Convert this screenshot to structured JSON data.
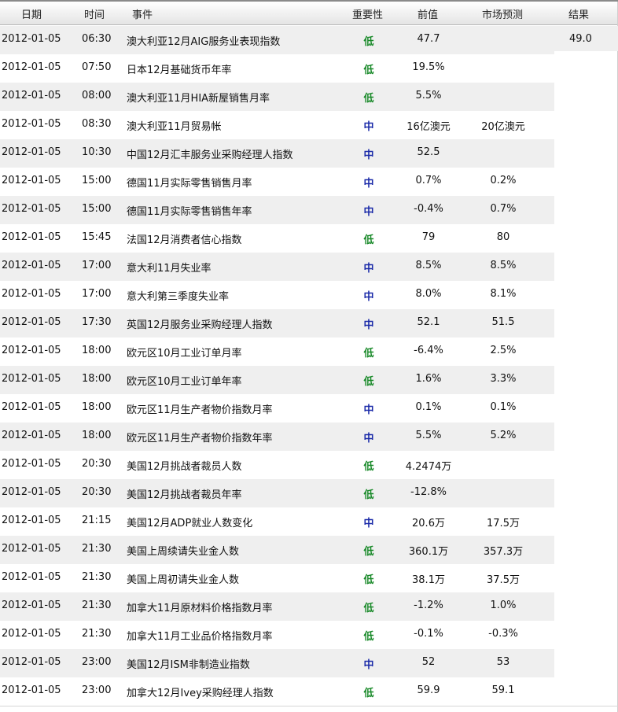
{
  "columns": {
    "date": "日期",
    "time": "时间",
    "event": "事件",
    "importance": "重要性",
    "previous": "前值",
    "forecast": "市场预测",
    "result": "结果"
  },
  "colors": {
    "low": "#1a8a2a",
    "mid": "#1a2aa8",
    "row_shade": "#efefef"
  },
  "rows": [
    {
      "date": "2012-01-05",
      "time": "06:30",
      "event": "澳大利亚12月AIG服务业表现指数",
      "importance": "低",
      "previous": "47.7",
      "forecast": "",
      "result": "49.0"
    },
    {
      "date": "2012-01-05",
      "time": "07:50",
      "event": "日本12月基础货币年率",
      "importance": "低",
      "previous": "19.5%",
      "forecast": "",
      "result": ""
    },
    {
      "date": "2012-01-05",
      "time": "08:00",
      "event": "澳大利亚11月HIA新屋销售月率",
      "importance": "低",
      "previous": "5.5%",
      "forecast": "",
      "result": ""
    },
    {
      "date": "2012-01-05",
      "time": "08:30",
      "event": "澳大利亚11月贸易帐",
      "importance": "中",
      "previous": "16亿澳元",
      "forecast": "20亿澳元",
      "result": ""
    },
    {
      "date": "2012-01-05",
      "time": "10:30",
      "event": "中国12月汇丰服务业采购经理人指数",
      "importance": "中",
      "previous": "52.5",
      "forecast": "",
      "result": ""
    },
    {
      "date": "2012-01-05",
      "time": "15:00",
      "event": "德国11月实际零售销售月率",
      "importance": "中",
      "previous": "0.7%",
      "forecast": "0.2%",
      "result": ""
    },
    {
      "date": "2012-01-05",
      "time": "15:00",
      "event": "德国11月实际零售销售年率",
      "importance": "中",
      "previous": "-0.4%",
      "forecast": "0.7%",
      "result": ""
    },
    {
      "date": "2012-01-05",
      "time": "15:45",
      "event": "法国12月消费者信心指数",
      "importance": "低",
      "previous": "79",
      "forecast": "80",
      "result": ""
    },
    {
      "date": "2012-01-05",
      "time": "17:00",
      "event": "意大利11月失业率",
      "importance": "中",
      "previous": "8.5%",
      "forecast": "8.5%",
      "result": ""
    },
    {
      "date": "2012-01-05",
      "time": "17:00",
      "event": "意大利第三季度失业率",
      "importance": "中",
      "previous": "8.0%",
      "forecast": "8.1%",
      "result": ""
    },
    {
      "date": "2012-01-05",
      "time": "17:30",
      "event": "英国12月服务业采购经理人指数",
      "importance": "中",
      "previous": "52.1",
      "forecast": "51.5",
      "result": ""
    },
    {
      "date": "2012-01-05",
      "time": "18:00",
      "event": "欧元区10月工业订单月率",
      "importance": "低",
      "previous": "-6.4%",
      "forecast": "2.5%",
      "result": ""
    },
    {
      "date": "2012-01-05",
      "time": "18:00",
      "event": "欧元区10月工业订单年率",
      "importance": "低",
      "previous": "1.6%",
      "forecast": "3.3%",
      "result": ""
    },
    {
      "date": "2012-01-05",
      "time": "18:00",
      "event": "欧元区11月生产者物价指数月率",
      "importance": "中",
      "previous": "0.1%",
      "forecast": "0.1%",
      "result": ""
    },
    {
      "date": "2012-01-05",
      "time": "18:00",
      "event": "欧元区11月生产者物价指数年率",
      "importance": "中",
      "previous": "5.5%",
      "forecast": "5.2%",
      "result": ""
    },
    {
      "date": "2012-01-05",
      "time": "20:30",
      "event": "美国12月挑战者裁员人数",
      "importance": "低",
      "previous": "4.2474万",
      "forecast": "",
      "result": ""
    },
    {
      "date": "2012-01-05",
      "time": "20:30",
      "event": "美国12月挑战者裁员年率",
      "importance": "低",
      "previous": "-12.8%",
      "forecast": "",
      "result": ""
    },
    {
      "date": "2012-01-05",
      "time": "21:15",
      "event": "美国12月ADP就业人数变化",
      "importance": "中",
      "previous": "20.6万",
      "forecast": "17.5万",
      "result": ""
    },
    {
      "date": "2012-01-05",
      "time": "21:30",
      "event": "美国上周续请失业金人数",
      "importance": "低",
      "previous": "360.1万",
      "forecast": "357.3万",
      "result": ""
    },
    {
      "date": "2012-01-05",
      "time": "21:30",
      "event": "美国上周初请失业金人数",
      "importance": "低",
      "previous": "38.1万",
      "forecast": "37.5万",
      "result": ""
    },
    {
      "date": "2012-01-05",
      "time": "21:30",
      "event": "加拿大11月原材料价格指数月率",
      "importance": "低",
      "previous": "-1.2%",
      "forecast": "1.0%",
      "result": ""
    },
    {
      "date": "2012-01-05",
      "time": "21:30",
      "event": "加拿大11月工业品价格指数月率",
      "importance": "低",
      "previous": "-0.1%",
      "forecast": "-0.3%",
      "result": ""
    },
    {
      "date": "2012-01-05",
      "time": "23:00",
      "event": "美国12月ISM非制造业指数",
      "importance": "中",
      "previous": "52",
      "forecast": "53",
      "result": ""
    },
    {
      "date": "2012-01-05",
      "time": "23:00",
      "event": "加拿大12月Ivey采购经理人指数",
      "importance": "低",
      "previous": "59.9",
      "forecast": "59.1",
      "result": ""
    }
  ]
}
